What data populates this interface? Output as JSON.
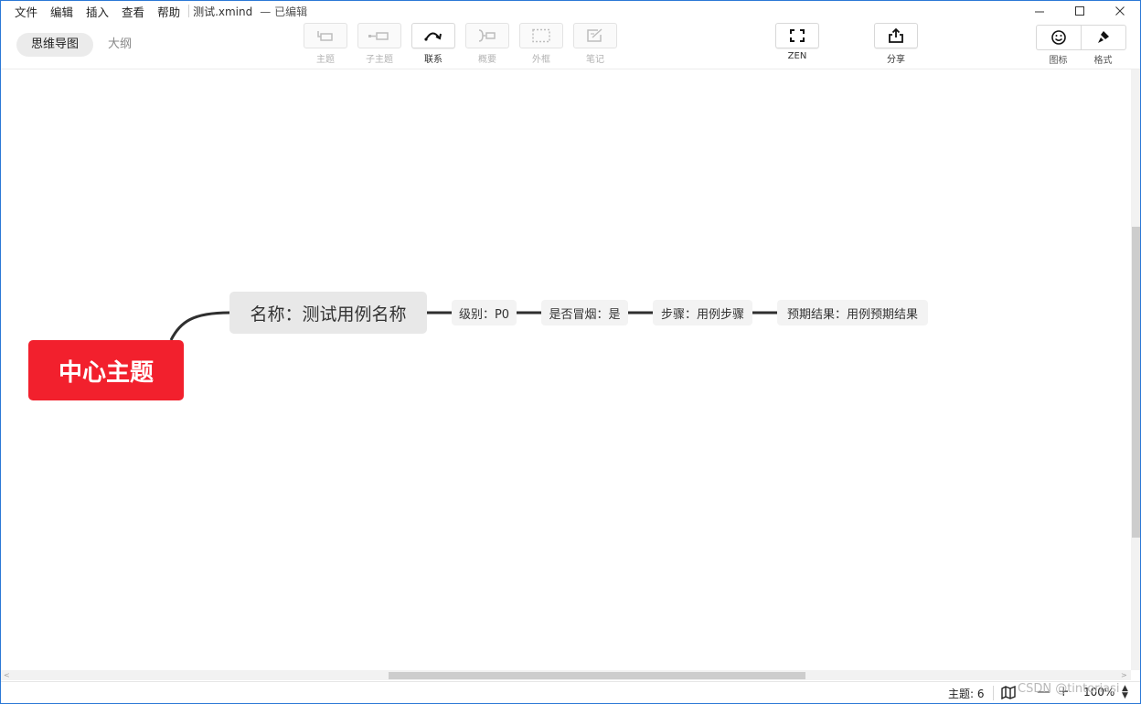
{
  "menu": [
    "文件",
    "编辑",
    "插入",
    "查看",
    "帮助"
  ],
  "document": {
    "title": "测试.xmind",
    "status": "— 已编辑"
  },
  "window_controls": {
    "minimize": "—",
    "maximize": "☐",
    "close": "✕"
  },
  "modes": {
    "mindmap": "思维导图",
    "outline": "大纲"
  },
  "toolbar": {
    "topic": "主题",
    "subtopic": "子主题",
    "relationship": "联系",
    "summary": "概要",
    "boundary": "外框",
    "note": "笔记",
    "zen": "ZEN",
    "share": "分享",
    "icon": "图标",
    "format": "格式"
  },
  "map": {
    "central_topic": "中心主题",
    "main_topic": "名称：测试用例名称",
    "subtopics": [
      "级别：P0",
      "是否冒烟：是",
      "步骤：用例步骤",
      "预期结果：用例预期结果"
    ]
  },
  "status": {
    "topic_count": "主题: 6",
    "watermark": "CSDN @tintoriasi",
    "zoom_minus": "—",
    "zoom_plus": "+",
    "zoom": "100%"
  },
  "colors": {
    "central_topic": "#f2202d",
    "main_topic_bg": "#e8e8e8",
    "subtopic_bg": "#f3f3f3",
    "connector": "#2f2f2f",
    "window_border": "#2b78d6"
  }
}
